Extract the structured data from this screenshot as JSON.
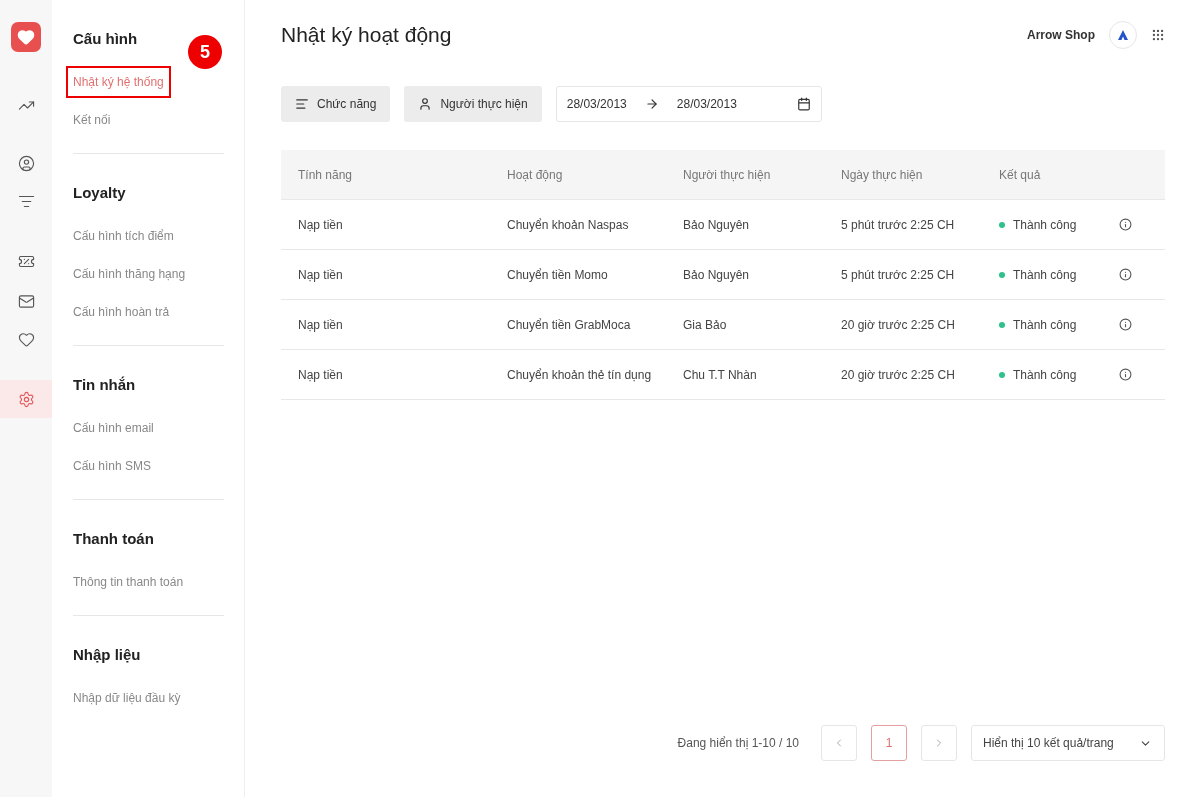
{
  "rail": [
    {
      "selected": false
    },
    {
      "selected": false
    },
    {
      "selected": false
    },
    {
      "selected": false
    },
    {
      "selected": false
    },
    {
      "selected": false
    },
    {
      "selected": true
    }
  ],
  "sidebar": {
    "groups": [
      {
        "title": "Cấu hình",
        "items": [
          {
            "label": "Nhật ký hệ thống",
            "selected": true,
            "callout": "5"
          },
          {
            "label": "Kết nối",
            "selected": false
          }
        ]
      },
      {
        "title": "Loyalty",
        "items": [
          {
            "label": "Cấu hình tích điểm",
            "selected": false
          },
          {
            "label": "Cấu hình thăng hạng",
            "selected": false
          },
          {
            "label": "Cấu hình hoàn trả",
            "selected": false
          }
        ]
      },
      {
        "title": "Tin nhắn",
        "items": [
          {
            "label": "Cấu hình email",
            "selected": false
          },
          {
            "label": "Cấu hình SMS",
            "selected": false
          }
        ]
      },
      {
        "title": "Thanh toán",
        "items": [
          {
            "label": "Thông tin thanh toán",
            "selected": false
          }
        ]
      },
      {
        "title": "Nhập liệu",
        "items": [
          {
            "label": "Nhập dữ liệu đầu kỳ",
            "selected": false
          }
        ]
      }
    ]
  },
  "page_title": "Nhật ký hoạt động",
  "account": {
    "name": "Arrow Shop"
  },
  "filters": [
    {
      "label": "Chức năng"
    },
    {
      "label": "Người thực hiện"
    }
  ],
  "date_range": {
    "from": "28/03/2013",
    "to": "28/03/2013"
  },
  "table": {
    "columns": [
      "Tính năng",
      "Hoạt động",
      "Người thực hiện",
      "Ngày thực hiện",
      "Kết quả"
    ],
    "rows": [
      {
        "cells": [
          "Nạp tiền",
          "Chuyển khoản Naspas",
          "Bảo Nguyên",
          "5 phút trước 2:25 CH"
        ],
        "result": "Thành công",
        "color": "#2fc18c"
      },
      {
        "cells": [
          "Nạp tiền",
          "Chuyển tiền Momo",
          "Bảo Nguyên",
          "5 phút trước 2:25 CH"
        ],
        "result": "Thành công",
        "color": "#2fc18c"
      },
      {
        "cells": [
          "Nạp tiền",
          "Chuyển tiền GrabMoca",
          "Gia Bảo",
          "20 giờ trước 2:25 CH"
        ],
        "result": "Thành công",
        "color": "#2fc18c"
      },
      {
        "cells": [
          "Nạp tiền",
          "Chuyển khoản thẻ tín dụng",
          "Chu T.T Nhàn",
          "20 giờ trước 2:25 CH"
        ],
        "result": "Thành công",
        "color": "#2fc18c"
      }
    ]
  },
  "pagination": {
    "summary": "Đang hiển thị 1-10 / 10",
    "pages": [
      {
        "label": "1",
        "selected": true
      }
    ],
    "page_size": "Hiển thị 10 kết quả/trang"
  }
}
